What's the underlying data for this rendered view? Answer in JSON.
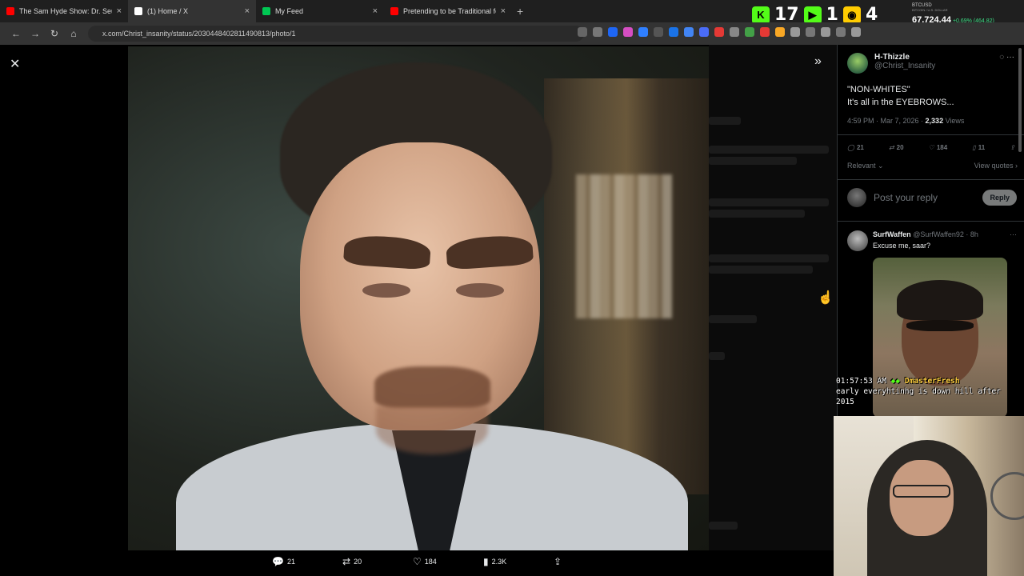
{
  "browser": {
    "tabs": [
      {
        "title": "The Sam Hyde Show: Dr. Seuss",
        "favicon_color": "#ff0000",
        "active": false
      },
      {
        "title": "(1) Home / X",
        "favicon_color": "#ffffff",
        "active": true
      },
      {
        "title": "My Feed",
        "favicon_color": "#00c853",
        "active": false
      },
      {
        "title": "Pretending to be Traditional for",
        "favicon_color": "#ff0000",
        "active": false
      }
    ],
    "new_tab": "+",
    "url": "x.com/Christ_insanity/status/2030448402811490813/photo/1"
  },
  "counters": [
    {
      "icon": "kick-icon",
      "glyph": "K",
      "color": "#53fc18",
      "value": "17"
    },
    {
      "icon": "play-icon",
      "glyph": "▶",
      "color": "#53fc18",
      "value": "1"
    },
    {
      "icon": "viewer-icon",
      "glyph": "◉",
      "color": "#ffcc00",
      "value": "4"
    }
  ],
  "ticker": {
    "symbol": "BTCUSD",
    "subtitle": "BITCOIN / U.S. DOLLAR",
    "price": "67,724.44",
    "change": "+0.69% (464.82)",
    "change_color": "#3ddc84"
  },
  "viewer": {
    "close": "✕",
    "expand": "»",
    "actions": [
      {
        "icon": "reply-icon",
        "glyph": "💬",
        "label": "21"
      },
      {
        "icon": "retweet-icon",
        "glyph": "⇄",
        "label": "20"
      },
      {
        "icon": "like-icon",
        "glyph": "♡",
        "label": "184"
      },
      {
        "icon": "views-icon",
        "glyph": "▮",
        "label": "2.3K"
      },
      {
        "icon": "share-icon",
        "glyph": "⇪",
        "label": ""
      }
    ]
  },
  "post": {
    "author": "H-Thizzle",
    "handle": "@Christ_Insanity",
    "text_line1": "\"NON-WHITES\"",
    "text_line2": "It's all in the EYEBROWS...",
    "time": "4:59 PM · Mar 7, 2026 · ",
    "views_count": "2,332",
    "views_label": " Views",
    "stats": {
      "replies": "21",
      "reposts": "20",
      "likes": "184",
      "bookmarks": "11"
    },
    "sort": "Relevant ⌄",
    "view_quotes": "View quotes ›",
    "reply_placeholder": "Post your reply",
    "reply_button": "Reply"
  },
  "reply1": {
    "name": "SurfWaffen",
    "handle": "@SurfWaffen92 · 8h",
    "text": "Excuse me, saar?"
  },
  "chat": {
    "time": "01:57:53 AM",
    "user": "DmasterFresh",
    "message": "early everyhtinhg is down hill after 2015"
  }
}
